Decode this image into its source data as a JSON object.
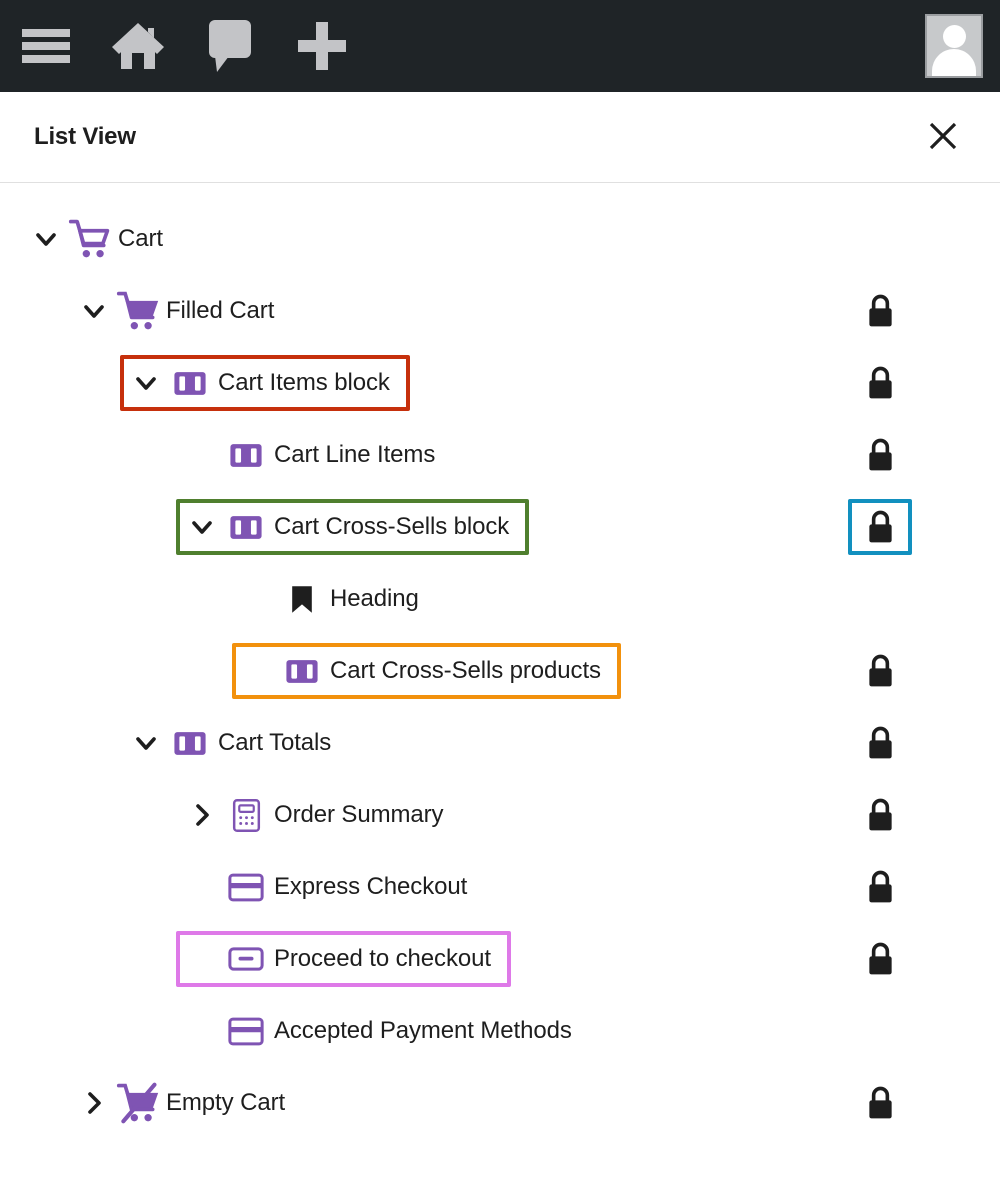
{
  "adminbar": {
    "items": [
      {
        "name": "menu-icon",
        "label": "Menu"
      },
      {
        "name": "home-icon",
        "label": "Home"
      },
      {
        "name": "comment-icon",
        "label": "Comments"
      },
      {
        "name": "plus-icon",
        "label": "New"
      }
    ],
    "avatar_label": "Account",
    "background": "#1f2427",
    "icon_color": "#c3c4c7"
  },
  "panel": {
    "title": "List View",
    "close_label": "✕",
    "close_icon": "close-icon"
  },
  "colors": {
    "block_purple": "#7f54b3",
    "lock_dark": "#1e1e1e",
    "text": "#1e1e1e",
    "highlight_red": "#c6300c",
    "highlight_green": "#4f7f2e",
    "highlight_cyan": "#1290bf",
    "highlight_orange": "#f2910d",
    "highlight_magenta": "#de79e8"
  },
  "tree": {
    "rows": [
      {
        "label": "Cart",
        "icon": "cart-outline-icon",
        "depth": 0,
        "chevron": "down",
        "locked": false,
        "highlight": null,
        "lock_highlight": null
      },
      {
        "label": "Filled Cart",
        "icon": "cart-filled-icon",
        "depth": 1,
        "chevron": "down",
        "locked": true,
        "highlight": null,
        "lock_highlight": null
      },
      {
        "label": "Cart Items block",
        "icon": "block-icon",
        "depth": 2,
        "chevron": "down",
        "locked": true,
        "highlight": "red",
        "lock_highlight": null
      },
      {
        "label": "Cart Line Items",
        "icon": "block-icon",
        "depth": 3,
        "chevron": "none",
        "locked": true,
        "highlight": null,
        "lock_highlight": null
      },
      {
        "label": "Cart Cross-Sells block",
        "icon": "block-icon",
        "depth": 3,
        "chevron": "down",
        "locked": true,
        "highlight": "green",
        "lock_highlight": "cyan"
      },
      {
        "label": "Heading",
        "icon": "heading-icon",
        "depth": 4,
        "chevron": "none",
        "locked": false,
        "highlight": null,
        "lock_highlight": null
      },
      {
        "label": "Cart Cross-Sells products",
        "icon": "block-icon",
        "depth": 4,
        "chevron": "none",
        "locked": true,
        "highlight": "orange",
        "lock_highlight": null
      },
      {
        "label": "Cart Totals",
        "icon": "block-icon",
        "depth": 2,
        "chevron": "down",
        "locked": true,
        "highlight": null,
        "lock_highlight": null
      },
      {
        "label": "Order Summary",
        "icon": "calculator-icon",
        "depth": 3,
        "chevron": "right",
        "locked": true,
        "highlight": null,
        "lock_highlight": null
      },
      {
        "label": "Express Checkout",
        "icon": "card-icon",
        "depth": 3,
        "chevron": "none",
        "locked": true,
        "highlight": null,
        "lock_highlight": null
      },
      {
        "label": "Proceed to checkout",
        "icon": "button-icon",
        "depth": 3,
        "chevron": "none",
        "locked": true,
        "highlight": "magenta",
        "lock_highlight": null
      },
      {
        "label": "Accepted Payment Methods",
        "icon": "card-icon",
        "depth": 3,
        "chevron": "none",
        "locked": false,
        "highlight": null,
        "lock_highlight": null
      },
      {
        "label": "Empty Cart",
        "icon": "cart-crossed-icon",
        "depth": 1,
        "chevron": "right",
        "locked": true,
        "highlight": null,
        "lock_highlight": null
      }
    ]
  }
}
